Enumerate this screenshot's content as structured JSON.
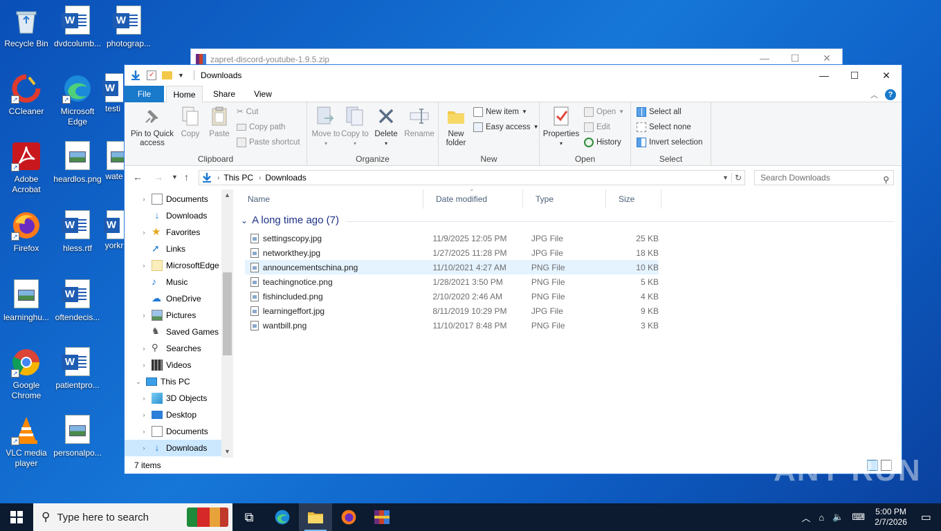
{
  "desktop": {
    "icons": [
      {
        "label": "Recycle Bin"
      },
      {
        "label": "dvdcolumb..."
      },
      {
        "label": "photograp..."
      },
      {
        "label": "CCleaner"
      },
      {
        "label": "Microsoft Edge"
      },
      {
        "label": "testi"
      },
      {
        "label": "Adobe Acrobat"
      },
      {
        "label": "heardlos.png"
      },
      {
        "label": "wate"
      },
      {
        "label": "Firefox"
      },
      {
        "label": "hless.rtf"
      },
      {
        "label": "yorkr"
      },
      {
        "label": "learninghu..."
      },
      {
        "label": "oftendecis..."
      },
      {
        "label": "Google Chrome"
      },
      {
        "label": "patientpro..."
      },
      {
        "label": "VLC media player"
      },
      {
        "label": "personalpo..."
      }
    ]
  },
  "background_window": {
    "title": "zapret-discord-youtube-1.9.5.zip"
  },
  "window": {
    "title": "Downloads",
    "tabs": {
      "file": "File",
      "home": "Home",
      "share": "Share",
      "view": "View"
    },
    "ribbon": {
      "clipboard": {
        "label": "Clipboard",
        "pin": "Pin to Quick access",
        "copy": "Copy",
        "paste": "Paste",
        "cut": "Cut",
        "copy_path": "Copy path",
        "paste_shortcut": "Paste shortcut"
      },
      "organize": {
        "label": "Organize",
        "move_to": "Move to",
        "copy_to": "Copy to",
        "delete": "Delete",
        "rename": "Rename"
      },
      "new": {
        "label": "New",
        "new_folder": "New folder",
        "new_item": "New item",
        "easy_access": "Easy access"
      },
      "open": {
        "label": "Open",
        "properties": "Properties",
        "open": "Open",
        "edit": "Edit",
        "history": "History"
      },
      "select": {
        "label": "Select",
        "select_all": "Select all",
        "select_none": "Select none",
        "invert": "Invert selection"
      }
    },
    "address": {
      "segments": [
        "This PC",
        "Downloads"
      ]
    },
    "search": {
      "placeholder": "Search Downloads"
    },
    "nav": [
      {
        "label": "Documents",
        "expand": true
      },
      {
        "label": "Downloads",
        "expand": false
      },
      {
        "label": "Favorites",
        "expand": true
      },
      {
        "label": "Links",
        "expand": false
      },
      {
        "label": "MicrosoftEdge",
        "expand": true
      },
      {
        "label": "Music",
        "expand": false
      },
      {
        "label": "OneDrive",
        "expand": false
      },
      {
        "label": "Pictures",
        "expand": true
      },
      {
        "label": "Saved Games",
        "expand": false
      },
      {
        "label": "Searches",
        "expand": true
      },
      {
        "label": "Videos",
        "expand": true
      },
      {
        "label": "This PC",
        "expand": "open"
      },
      {
        "label": "3D Objects",
        "expand": true
      },
      {
        "label": "Desktop",
        "expand": true
      },
      {
        "label": "Documents",
        "expand": true
      },
      {
        "label": "Downloads",
        "expand": true,
        "selected": true
      }
    ],
    "columns": {
      "name": "Name",
      "date": "Date modified",
      "type": "Type",
      "size": "Size"
    },
    "group_header": "A long time ago (7)",
    "files": [
      {
        "name": "settingscopy.jpg",
        "date": "11/9/2025 12:05 PM",
        "type": "JPG File",
        "size": "25 KB"
      },
      {
        "name": "networkthey.jpg",
        "date": "1/27/2025 11:28 PM",
        "type": "JPG File",
        "size": "18 KB"
      },
      {
        "name": "announcementschina.png",
        "date": "11/10/2021 4:27 AM",
        "type": "PNG File",
        "size": "10 KB"
      },
      {
        "name": "teachingnotice.png",
        "date": "1/28/2021 3:50 PM",
        "type": "PNG File",
        "size": "5 KB"
      },
      {
        "name": "fishincluded.png",
        "date": "2/10/2020 2:46 AM",
        "type": "PNG File",
        "size": "4 KB"
      },
      {
        "name": "learningeffort.jpg",
        "date": "8/11/2019 10:29 PM",
        "type": "JPG File",
        "size": "9 KB"
      },
      {
        "name": "wantbill.png",
        "date": "11/10/2017 8:48 PM",
        "type": "PNG File",
        "size": "3 KB"
      }
    ],
    "status": "7 items"
  },
  "taskbar": {
    "search_placeholder": "Type here to search",
    "time": "5:00 PM",
    "date": "2/7/2026"
  },
  "watermark": "ANY RUN"
}
